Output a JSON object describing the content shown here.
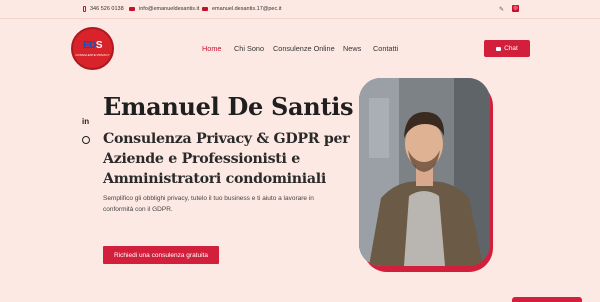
{
  "topbar": {
    "phone": "346 526 0138",
    "email": "info@emanueldesantis.it",
    "pec": "emanuel.desantis.17@pec.it"
  },
  "brand": {
    "logo_text_1": "ED",
    "logo_text_2": "S",
    "logo_subtext": "CONSULENTE PRIVACY"
  },
  "nav": {
    "items": [
      "Home",
      "Chi Sono",
      "Consulenze Online",
      "News",
      "Contatti"
    ],
    "active": "Home"
  },
  "chat_label": "Chat",
  "social": {
    "linkedin": "in"
  },
  "hero": {
    "name": "Emanuel De Santis",
    "subtitle": "Consulenza Privacy & GDPR per Aziende e Professionisti e Amministratori condominiali",
    "description": "Semplifico gli obblighi privacy, tutelo il tuo business e ti aiuto a lavorare in conformità con il GDPR.",
    "cta": "Richiedi una consulenza gratuita"
  },
  "colors": {
    "accent": "#d21f3c",
    "background": "#fde9e3"
  }
}
